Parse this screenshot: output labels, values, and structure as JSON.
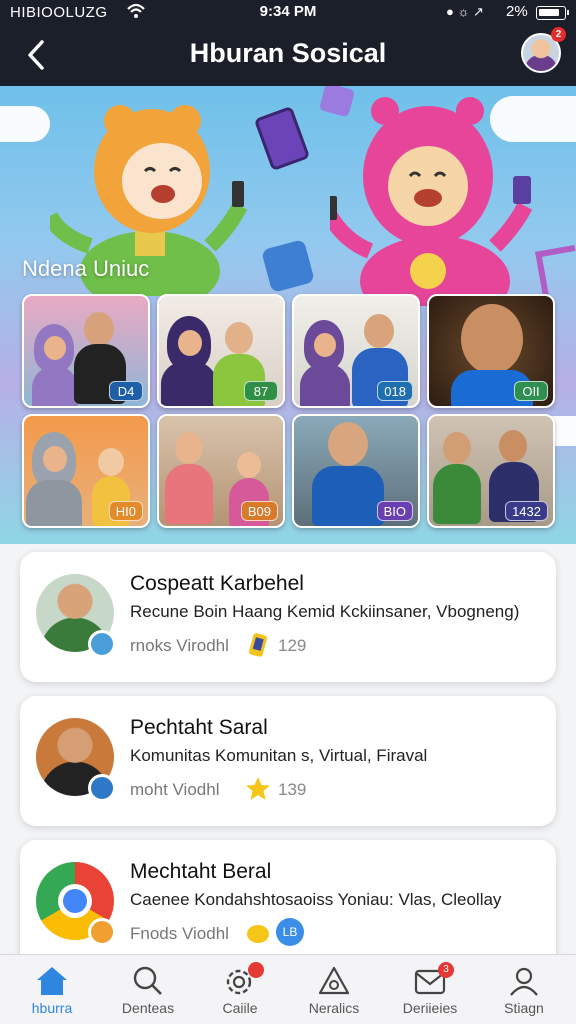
{
  "status_bar": {
    "carrier": "HIBIOOLUZG",
    "time": "9:34 PM",
    "battery": "2%"
  },
  "header": {
    "title": "Hburan Sosical",
    "notification_count": "2"
  },
  "hero": {
    "label": "Ndena Uniuc",
    "tiles": [
      {
        "badge": "D4",
        "badge_color": "#1f5fa8"
      },
      {
        "badge": "87",
        "badge_color": "#2f8f45"
      },
      {
        "badge": "018",
        "badge_color": "#1f6fb0"
      },
      {
        "badge": "OII",
        "badge_color": "#2e8f50"
      },
      {
        "badge": "HI0",
        "badge_color": "#e38a2a"
      },
      {
        "badge": "B09",
        "badge_color": "#d9792a"
      },
      {
        "badge": "BIO",
        "badge_color": "#6a3fb0"
      },
      {
        "badge": "1432",
        "badge_color": "#3a3a8a"
      }
    ]
  },
  "cards": [
    {
      "title": "Cospeatt Karbehel",
      "description": "Recune Boin Haang Kemid Kckiinsaner, Vbogneng)",
      "meta": "rnoks Virodhl",
      "count": "129",
      "emoji": "phone-sticker-icon"
    },
    {
      "title": "Pechtaht Saral",
      "description": "Komunitas Komunitan s, Virtual, Firaval",
      "meta": "moht Viodhl",
      "count": "139",
      "emoji": "star-icon"
    },
    {
      "title": "Mechtaht Beral",
      "description": "Caenee Kondahshtosaoiss Yoniau: Vlas, Cleollay",
      "meta": "Fnods Viodhl",
      "count": "",
      "emoji": "hand-icon"
    }
  ],
  "tabs": [
    {
      "label": "hburra",
      "icon": "home-icon",
      "active": true
    },
    {
      "label": "Denteas",
      "icon": "search-icon"
    },
    {
      "label": "Caiile",
      "icon": "gear-icon",
      "badge": ""
    },
    {
      "label": "Neralics",
      "icon": "house-outline-icon"
    },
    {
      "label": "Deriieies",
      "icon": "inbox-icon",
      "badge": "3"
    },
    {
      "label": "Stiagn",
      "icon": "profile-icon"
    }
  ],
  "colors": {
    "accent": "#2e86de",
    "header_bg": "#1b1f2a",
    "badge_red": "#e53935"
  }
}
